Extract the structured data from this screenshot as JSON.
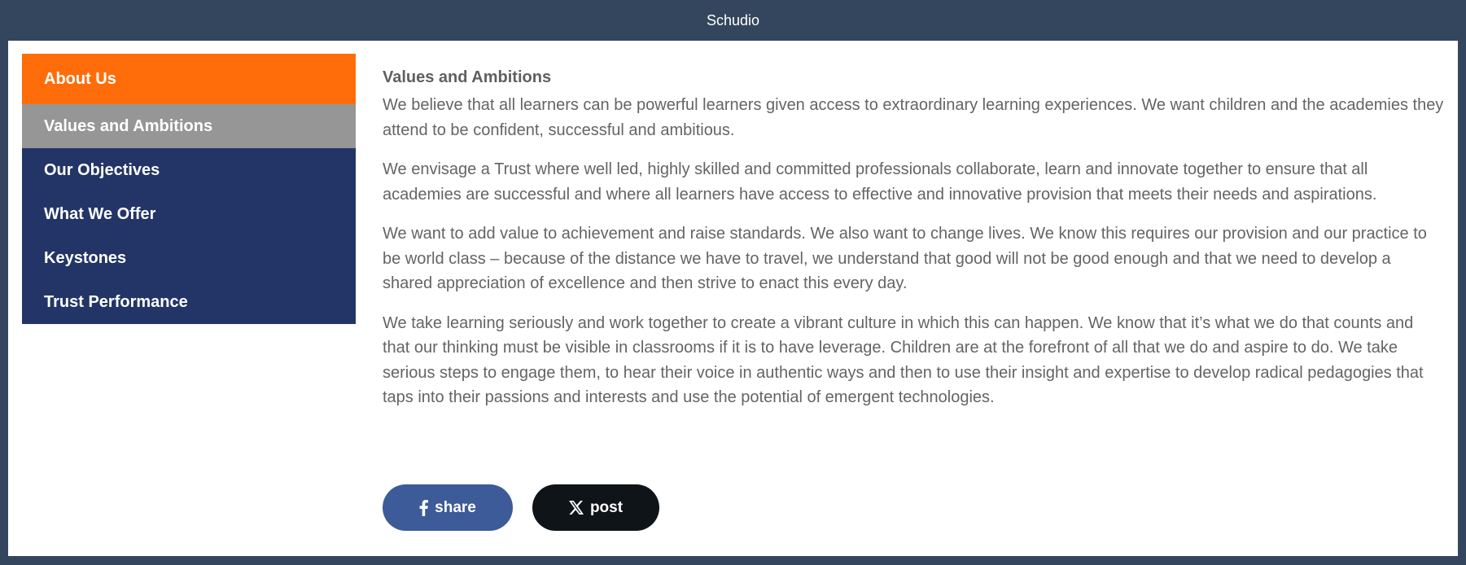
{
  "window": {
    "title": "Schudio"
  },
  "sidebar": {
    "header": "About Us",
    "items": [
      {
        "label": "Values and Ambitions",
        "active": true
      },
      {
        "label": "Our Objectives",
        "active": false
      },
      {
        "label": "What We Offer",
        "active": false
      },
      {
        "label": "Keystones",
        "active": false
      },
      {
        "label": "Trust Performance",
        "active": false
      }
    ]
  },
  "main": {
    "heading": "Values and Ambitions",
    "paragraphs": [
      "We believe that all learners can be powerful learners given access to extraordinary learning experiences. We want children and the academies they attend to be confident, successful and ambitious.",
      "We envisage a Trust where well led, highly skilled and committed professionals collaborate, learn and innovate together to ensure that all academies are successful and where all learners have access to effective and innovative provision that meets their needs and aspirations.",
      "We want to add value to achievement and raise standards. We also want to change lives. We know this requires our provision and our practice to be world class – because of the distance we have to travel, we understand that good will not be good enough and that we need to develop a shared appreciation of excellence and then strive to enact this every day.",
      "We take learning seriously and work together to create a vibrant culture in which this can happen.  We know that it’s what we do that counts and that our thinking must be visible in classrooms if it is to have leverage.  Children are at the forefront of all that we do and aspire to do. We take serious steps to engage them, to hear their voice in authentic ways and then to use their insight and expertise to develop radical pedagogies that taps into their passions and interests and use the potential of emergent technologies."
    ]
  },
  "share": {
    "facebook_label": "share",
    "facebook_icon": "facebook-icon",
    "x_label": "post",
    "x_icon": "x-icon"
  },
  "colors": {
    "titlebar": "#34465d",
    "nav_header": "#ff6d0a",
    "nav_item": "#233567",
    "nav_active": "#969696",
    "facebook": "#3d5b98",
    "x": "#0f1419"
  }
}
